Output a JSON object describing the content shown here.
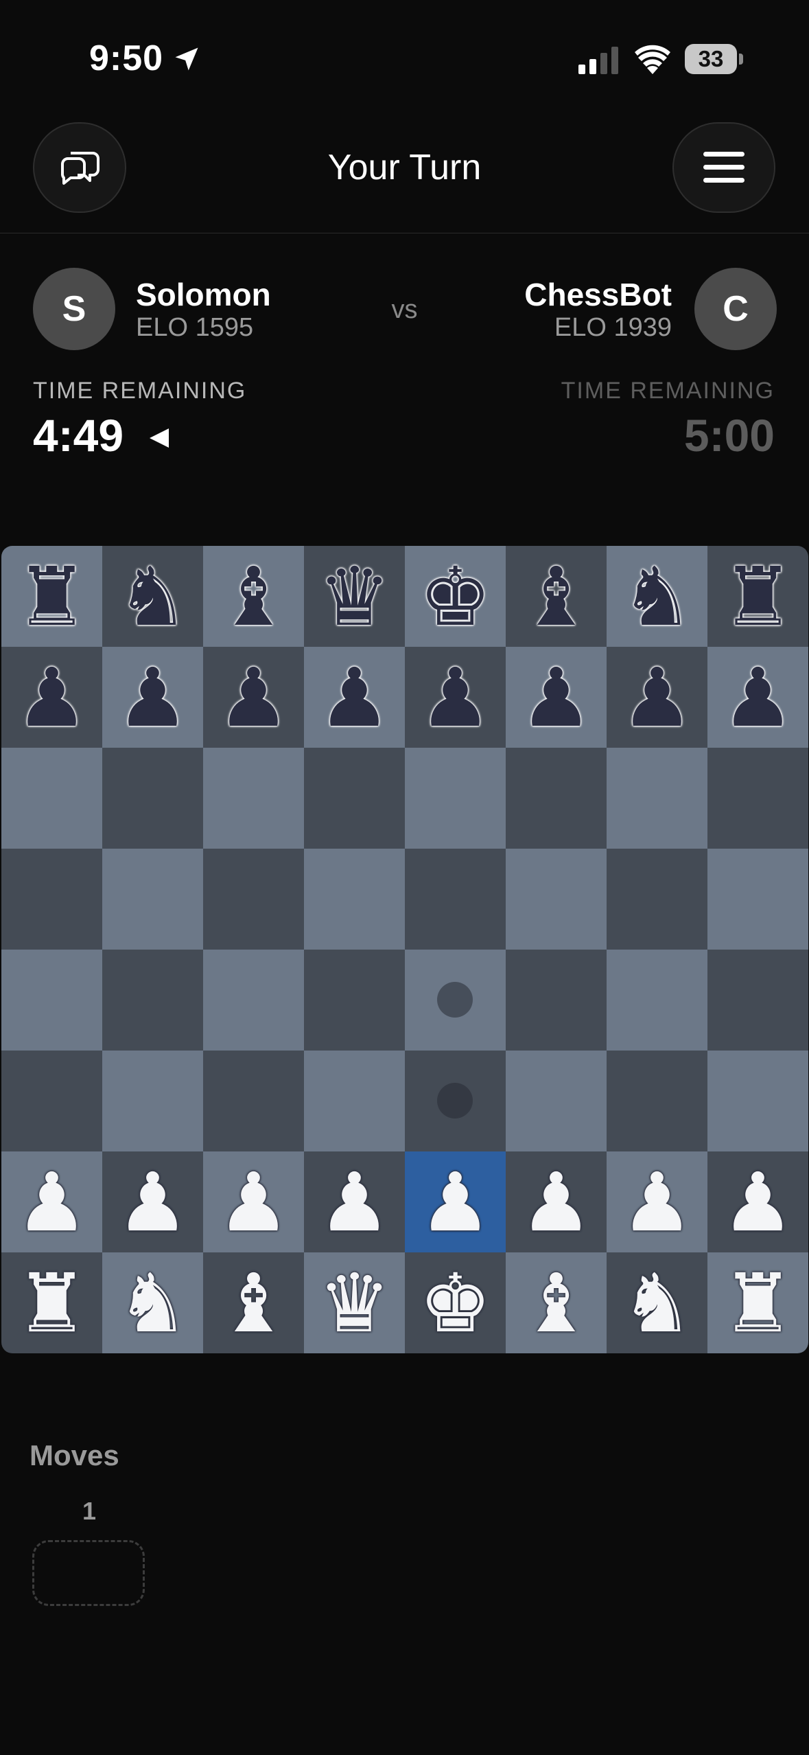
{
  "status_bar": {
    "time": "9:50",
    "battery": "33",
    "icons": [
      "location-arrow-icon",
      "cellular-signal-icon",
      "wifi-icon",
      "battery-icon"
    ]
  },
  "header": {
    "title": "Your Turn",
    "left_icon": "chat-bubbles-icon",
    "right_icon": "hamburger-menu-icon"
  },
  "players": {
    "vs": "vs",
    "player1": {
      "initial": "S",
      "name": "Solomon",
      "elo": "ELO 1595",
      "time_label": "TIME REMAINING",
      "time": "4:49",
      "active": true
    },
    "player2": {
      "initial": "C",
      "name": "ChessBot",
      "elo": "ELO 1939",
      "time_label": "TIME REMAINING",
      "time": "5:00",
      "active": false
    }
  },
  "board": {
    "ranks": [
      [
        "r",
        "n",
        "b",
        "q",
        "k",
        "b",
        "n",
        "r"
      ],
      [
        "p",
        "p",
        "p",
        "p",
        "p",
        "p",
        "p",
        "p"
      ],
      [
        "",
        "",
        "",
        "",
        "",
        "",
        "",
        ""
      ],
      [
        "",
        "",
        "",
        "",
        "",
        "",
        "",
        ""
      ],
      [
        "",
        "",
        "",
        "",
        "",
        "",
        "",
        ""
      ],
      [
        "",
        "",
        "",
        "",
        "",
        "",
        "",
        ""
      ],
      [
        "P",
        "P",
        "P",
        "P",
        "P",
        "P",
        "P",
        "P"
      ],
      [
        "R",
        "N",
        "B",
        "Q",
        "K",
        "B",
        "N",
        "R"
      ]
    ],
    "selected_square": [
      6,
      4
    ],
    "move_hints": [
      [
        4,
        4
      ],
      [
        5,
        4
      ]
    ],
    "colors": {
      "light": "#6c7888",
      "dark": "#444b55",
      "selected": "#2d5fa0"
    }
  },
  "moves": {
    "title": "Moves",
    "rows": [
      {
        "number": "1",
        "white": "",
        "black": ""
      }
    ]
  }
}
